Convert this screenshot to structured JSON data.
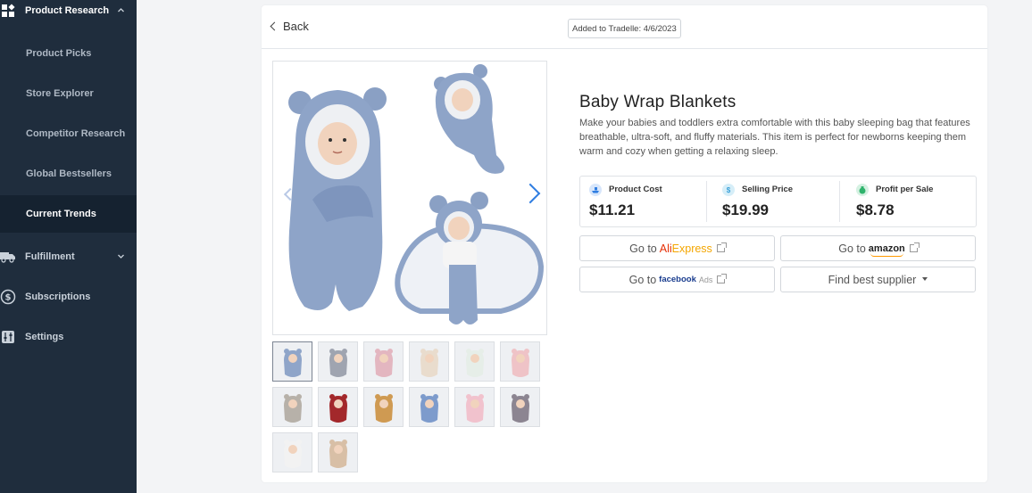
{
  "sidebar": {
    "product_research": "Product Research",
    "items": [
      {
        "label": "Product Picks"
      },
      {
        "label": "Store Explorer"
      },
      {
        "label": "Competitor Research"
      },
      {
        "label": "Global Bestsellers"
      },
      {
        "label": "Current Trends"
      }
    ],
    "fulfillment": "Fulfillment",
    "subscriptions": "Subscriptions",
    "settings": "Settings"
  },
  "header": {
    "back_label": "Back",
    "added_label": "Added to Tradelle: 4/6/2023"
  },
  "product": {
    "title": "Baby Wrap Blankets",
    "description": "Make your babies and toddlers extra comfortable with this baby sleeping bag that features breathable, ultra-soft, and fluffy materials. This item is perfect for newborns keeping them warm and cozy when getting a relaxing sleep.",
    "stats": [
      {
        "label": "Product Cost",
        "value": "$11.21"
      },
      {
        "label": "Selling Price",
        "value": "$19.99"
      },
      {
        "label": "Profit per Sale",
        "value": "$8.78"
      }
    ]
  },
  "buttons": {
    "go_to": "Go to",
    "aliexpress_ali": "Ali",
    "aliexpress_express": "Express",
    "amazon": "amazon",
    "facebook": "facebook",
    "facebook_ads": "Ads",
    "find_supplier": "Find best supplier"
  },
  "colors": {
    "sidebar_bg": "#1f2d3d",
    "sidebar_active_bg": "#152230",
    "accent_blue": "#2f7de1",
    "product_cost_icon": "#2f7de1",
    "selling_price_icon": "#3aa0d8",
    "profit_icon": "#2fb36c"
  },
  "thumbnails": [
    {
      "tone": "#8fa5c9"
    },
    {
      "tone": "#9fa4b0"
    },
    {
      "tone": "#e3b6c0"
    },
    {
      "tone": "#e9dccd"
    },
    {
      "tone": "#e6eee8"
    },
    {
      "tone": "#efc3c7"
    },
    {
      "tone": "#b7b1a9"
    },
    {
      "tone": "#a3282b"
    },
    {
      "tone": "#cf9a52"
    },
    {
      "tone": "#7d9bcc"
    },
    {
      "tone": "#f1c2cd"
    },
    {
      "tone": "#8c8591"
    },
    {
      "tone": "#f2f2f2"
    },
    {
      "tone": "#d8bfa6"
    }
  ]
}
